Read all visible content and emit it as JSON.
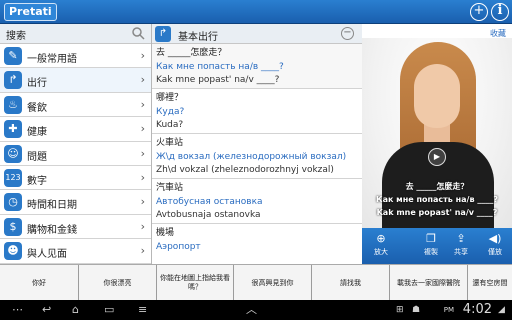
{
  "app": {
    "logo": "Pretati"
  },
  "topbar": {
    "add_icon": "plus-icon",
    "info_icon": "info-icon"
  },
  "sidebar": {
    "search_label": "搜索",
    "items": [
      {
        "label": "一般常用語",
        "icon": "pen-icon"
      },
      {
        "label": "出行",
        "icon": "turn-arrow-icon"
      },
      {
        "label": "餐飲",
        "icon": "dining-icon"
      },
      {
        "label": "健康",
        "icon": "health-icon"
      },
      {
        "label": "問題",
        "icon": "question-face-icon"
      },
      {
        "label": "數字",
        "icon": "numbers-icon"
      },
      {
        "label": "時間和日期",
        "icon": "clock-icon"
      },
      {
        "label": "購物和金錢",
        "icon": "shopping-icon"
      },
      {
        "label": "與人见面",
        "icon": "people-icon"
      }
    ]
  },
  "phrases": {
    "header": "基本出行",
    "items": [
      {
        "zh": "去 _____怎麼走？",
        "ru": "Как мне попасть на/в ____?",
        "tr": "Kak mne popast' na/v ____?"
      },
      {
        "zh": "哪裡？",
        "ru": "Куда?",
        "tr": "Kuda?"
      },
      {
        "zh": "火車站",
        "ru": "Ж\\д вокзал (железнодорожный вокзал)",
        "tr": "Zh\\d vokzal (zheleznodorozhnyj vokzal)"
      },
      {
        "zh": "汽車站",
        "ru": "Автобусная остановка",
        "tr": "Avtobusnaja ostanovka"
      },
      {
        "zh": "機場",
        "ru": "Аэропорт",
        "tr": ""
      }
    ]
  },
  "video": {
    "cart_link": "收藏",
    "subtitle_zh": "去 _____怎麼走？",
    "subtitle_ru": "Как мне попасть на/в ____?",
    "subtitle_tr": "Kak mne popast' na/v ____?",
    "buttons": [
      {
        "label": "放大",
        "icon": "zoom-in-icon"
      },
      {
        "label": "複製",
        "icon": "copy-icon"
      },
      {
        "label": "共享",
        "icon": "share-icon"
      },
      {
        "label": "僅放",
        "icon": "speaker-icon"
      }
    ]
  },
  "strip": [
    "你好",
    "你很漂亮",
    "你能在地圖上指給我看嗎？",
    "很高興見到你",
    "請找我",
    "載我去一家國際醫院",
    "還有空房間"
  ],
  "statusbar": {
    "time": "4:02",
    "ampm": "PM"
  }
}
